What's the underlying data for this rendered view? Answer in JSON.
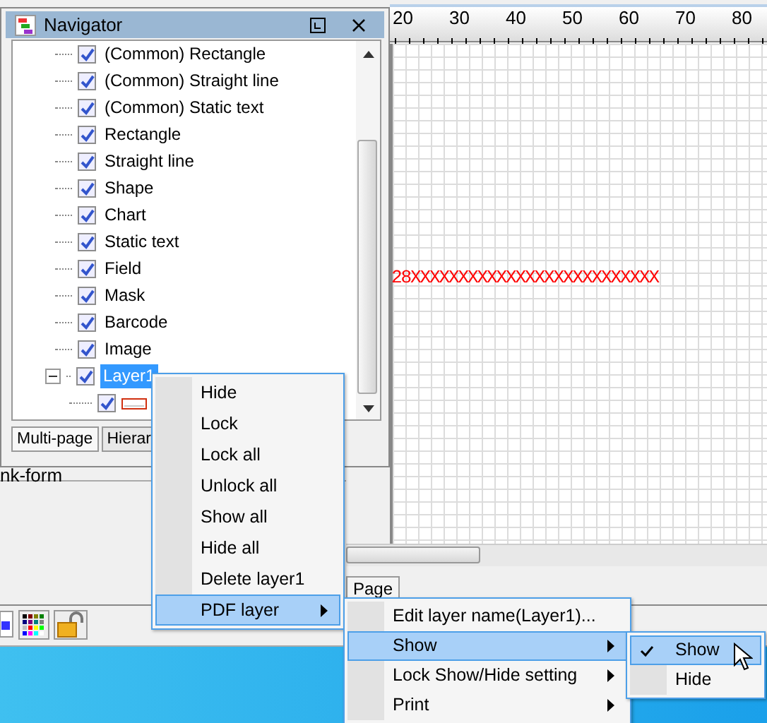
{
  "navigator": {
    "title": "Navigator",
    "tree": [
      {
        "label": "(Common) Rectangle",
        "checked": true
      },
      {
        "label": "(Common) Straight line",
        "checked": true
      },
      {
        "label": "(Common) Static text",
        "checked": true
      },
      {
        "label": "Rectangle",
        "checked": true
      },
      {
        "label": "Straight line",
        "checked": true
      },
      {
        "label": "Shape",
        "checked": true
      },
      {
        "label": "Chart",
        "checked": true
      },
      {
        "label": "Static text",
        "checked": true
      },
      {
        "label": "Field",
        "checked": true
      },
      {
        "label": "Mask",
        "checked": true
      },
      {
        "label": "Barcode",
        "checked": true
      },
      {
        "label": "Image",
        "checked": true
      },
      {
        "label": "Layer1",
        "checked": true,
        "selected": true,
        "expanded": true,
        "children": [
          {
            "kind": "rectangle",
            "checked": true
          }
        ]
      }
    ],
    "tabs": [
      {
        "label": "Multi-page",
        "selected": true
      },
      {
        "label": "Hierar",
        "selected": false
      }
    ]
  },
  "ruler": {
    "labels": [
      "20",
      "30",
      "40",
      "50",
      "60",
      "70",
      "80"
    ]
  },
  "canvas": {
    "text": "28XXXXXXXXXXXXXXXXXXXXXXXXXX"
  },
  "left_panel": {
    "label": "nk-form"
  },
  "page_tab": {
    "label": "Page"
  },
  "context_menu": [
    {
      "label": "Hide",
      "selected": false,
      "submenu": false
    },
    {
      "label": "Lock",
      "selected": false,
      "submenu": false
    },
    {
      "label": "Lock all",
      "selected": false,
      "submenu": false
    },
    {
      "label": "Unlock all",
      "selected": false,
      "submenu": false
    },
    {
      "label": "Show all",
      "selected": false,
      "submenu": false
    },
    {
      "label": "Hide all",
      "selected": false,
      "submenu": false
    },
    {
      "label": "Delete layer1",
      "selected": false,
      "submenu": false
    },
    {
      "label": "PDF layer",
      "selected": true,
      "submenu": true
    }
  ],
  "pdf_layer_menu": [
    {
      "label": "Edit layer name(Layer1)...",
      "selected": false,
      "submenu": false
    },
    {
      "label": "Show",
      "selected": true,
      "submenu": true
    },
    {
      "label": "Lock Show/Hide setting",
      "selected": false,
      "submenu": true
    },
    {
      "label": "Print",
      "selected": false,
      "submenu": true
    }
  ],
  "show_menu": [
    {
      "label": "Show",
      "selected": true,
      "checked": true
    },
    {
      "label": "Hide",
      "selected": false,
      "checked": false
    }
  ]
}
